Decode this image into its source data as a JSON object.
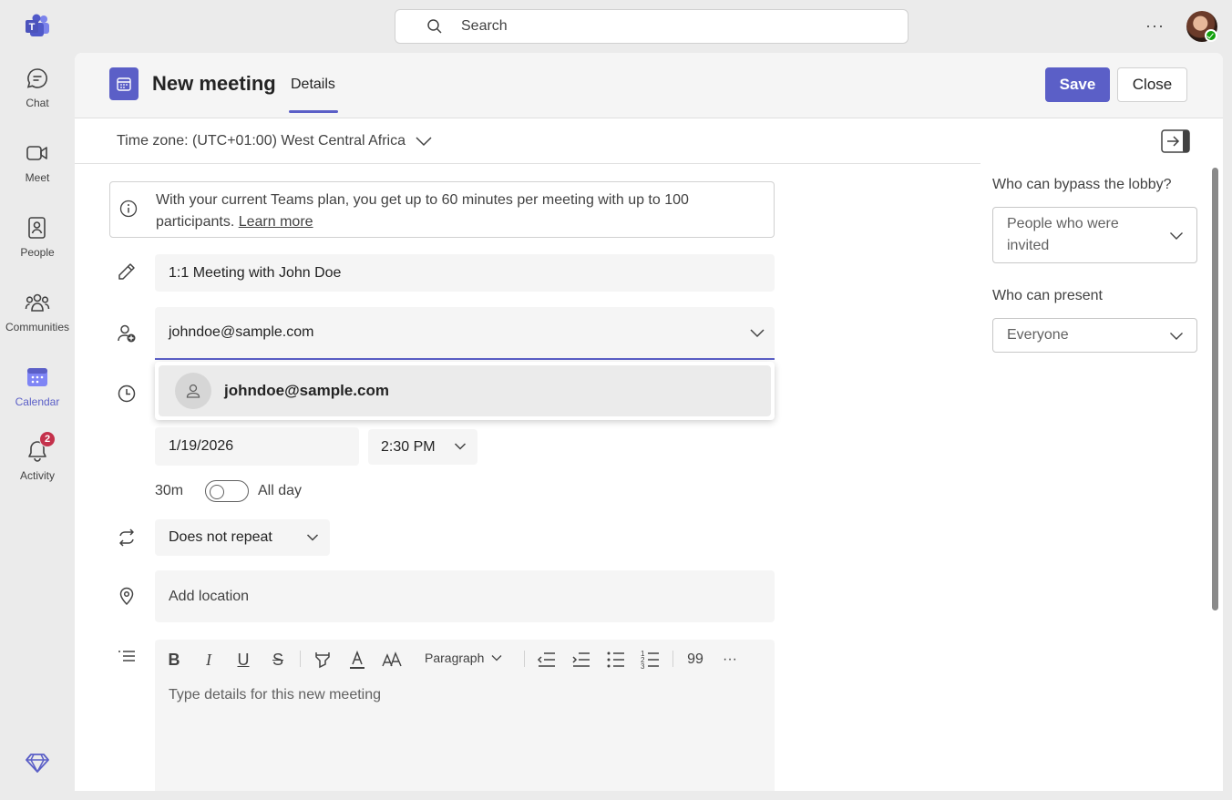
{
  "topbar": {
    "search_placeholder": "Search",
    "more_label": "···"
  },
  "rail": {
    "items": [
      {
        "label": "Chat",
        "icon": "chat-icon"
      },
      {
        "label": "Meet",
        "icon": "video-icon"
      },
      {
        "label": "People",
        "icon": "people-book-icon"
      },
      {
        "label": "Communities",
        "icon": "communities-icon"
      },
      {
        "label": "Calendar",
        "icon": "calendar-icon",
        "active": true
      },
      {
        "label": "Activity",
        "icon": "bell-icon",
        "badge": "2"
      }
    ]
  },
  "header": {
    "title": "New meeting",
    "tab": "Details",
    "save_label": "Save",
    "close_label": "Close"
  },
  "timezone": {
    "label": "Time zone: (UTC+01:00) West Central Africa"
  },
  "info": {
    "text": "With your current Teams plan, you get up to 60 minutes per meeting with up to 100 participants.",
    "link": "Learn more"
  },
  "form": {
    "title_value": "1:1 Meeting with John Doe",
    "attendee_value": "johndoe@sample.com",
    "suggestion": "johndoe@sample.com",
    "date_value": "1/19/2026",
    "time_value": "2:30 PM",
    "duration": "30m",
    "all_day_label": "All day",
    "all_day_on": false,
    "repeat_value": "Does not repeat",
    "location_placeholder": "Add location",
    "details_placeholder": "Type details for this new meeting",
    "paragraph_label": "Paragraph",
    "quote_label": "99",
    "more_label": "···"
  },
  "side": {
    "lobby_label": "Who can bypass the lobby?",
    "lobby_value": "People who were invited",
    "present_label": "Who can present",
    "present_value": "Everyone"
  },
  "colors": {
    "accent": "#5b5fc7",
    "badge": "#c4314b",
    "presence": "#13a10e"
  }
}
